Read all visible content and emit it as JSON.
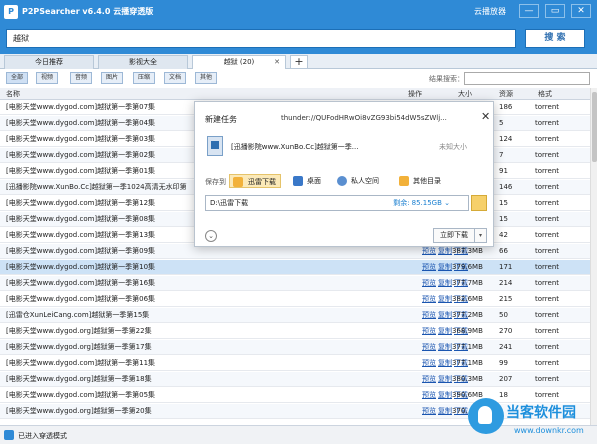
{
  "app": {
    "title": "P2PSearcher v6.4.0 云播穿透版",
    "cloud_link": "云播放器",
    "window_controls": [
      "—",
      "▭",
      "✕"
    ]
  },
  "search": {
    "query": "越狱",
    "button": "搜 索"
  },
  "tabs": [
    {
      "label": "今日推荐"
    },
    {
      "label": "影视大全"
    },
    {
      "label": "越狱 (20)"
    }
  ],
  "filters": [
    "全部",
    "视频",
    "音频",
    "图片",
    "压缩",
    "文档",
    "其他"
  ],
  "result_search_label": "结果搜索：",
  "columns": {
    "name": "名称",
    "ops": "操作",
    "size": "大小",
    "source": "资源",
    "format": "格式"
  },
  "rows": [
    {
      "name": "[电影天堂www.dygod.com]越狱第一季第07集",
      "size": "",
      "source": "186",
      "format": "torrent"
    },
    {
      "name": "[电影天堂www.dygod.com]越狱第一季第04集",
      "size": "",
      "source": "5",
      "format": "torrent"
    },
    {
      "name": "[电影天堂www.dygod.com]越狱第一季第03集",
      "size": "",
      "source": "124",
      "format": "torrent"
    },
    {
      "name": "[电影天堂www.dygod.com]越狱第一季第02集",
      "size": "",
      "source": "7",
      "format": "torrent"
    },
    {
      "name": "[电影天堂www.dygod.com]越狱第一季第01集",
      "size": "",
      "source": "91",
      "format": "torrent"
    },
    {
      "name": "[迅播影院www.XunBo.Cc]越狱第一季1024高清无水印第",
      "size": "",
      "source": "146",
      "format": "torrent"
    },
    {
      "name": "[电影天堂www.dygod.com]越狱第一季第12集",
      "size": "",
      "source": "15",
      "format": "torrent"
    },
    {
      "name": "[电影天堂www.dygod.com]越狱第一季第08集",
      "size": "",
      "source": "15",
      "format": "torrent"
    },
    {
      "name": "[电影天堂www.dygod.com]越狱第一季第13集",
      "size": "",
      "source": "42",
      "format": "torrent"
    },
    {
      "name": "[电影天堂www.dygod.com]越狱第一季第09集",
      "size": "387.3MB",
      "source": "66",
      "format": "torrent"
    },
    {
      "name": "[电影天堂www.dygod.com]越狱第一季第10集",
      "size": "379.6MB",
      "source": "171",
      "format": "torrent"
    },
    {
      "name": "[电影天堂www.dygod.com]越狱第一季第16集",
      "size": "377.7MB",
      "source": "214",
      "format": "torrent"
    },
    {
      "name": "[电影天堂www.dygod.com]越狱第一季第06集",
      "size": "382.6MB",
      "source": "215",
      "format": "torrent"
    },
    {
      "name": "[迅雷仓XunLeiCang.com]越狱第一季第15集",
      "size": "377.2MB",
      "source": "50",
      "format": "torrent"
    },
    {
      "name": "[电影天堂www.dygod.org]越狱第一季第22集",
      "size": "368.9MB",
      "source": "270",
      "format": "torrent"
    },
    {
      "name": "[电影天堂www.dygod.org]越狱第一季第17集",
      "size": "377.1MB",
      "source": "241",
      "format": "torrent"
    },
    {
      "name": "[电影天堂www.dygod.com]越狱第一季第11集",
      "size": "377.1MB",
      "source": "99",
      "format": "torrent"
    },
    {
      "name": "[电影天堂www.dygod.org]越狱第一季第18集",
      "size": "380.3MB",
      "source": "207",
      "format": "torrent"
    },
    {
      "name": "[电影天堂www.dygod.com]越狱第一季第05集",
      "size": "390.6MB",
      "source": "18",
      "format": "torrent"
    },
    {
      "name": "[电影天堂www.dygod.org]越狱第一季第20集",
      "size": "370.",
      "source": "",
      "format": ""
    }
  ],
  "row_actions": [
    "预览",
    "复制",
    "下载"
  ],
  "status": {
    "text": "已进入穿透模式"
  },
  "dialog": {
    "title": "新建任务",
    "url": "thunder://QUFodHRwOi8vZG93bi54dW5sZWlj...",
    "file_name": "[迅播影院www.XunBo.Cc]越狱第一季...",
    "file_size": "未知大小",
    "save_to_label": "保存到",
    "locations": [
      "迅雷下载",
      "桌面",
      "私人空间",
      "其他目录"
    ],
    "path": "D:\\迅雷下载",
    "free_label": "剩余:",
    "free_space": "85.15GB",
    "free_arrow": "⌄",
    "download_button": "立即下载",
    "download_arrow": "▾",
    "expand_icon": "⌄",
    "close_icon": "✕"
  },
  "watermark": {
    "text": "当客软件园",
    "url": "www.downkr.com"
  },
  "colors": {
    "titlebar": "#2f8ad6",
    "link": "#1a55b0",
    "selected_row": "#cde2f6"
  }
}
